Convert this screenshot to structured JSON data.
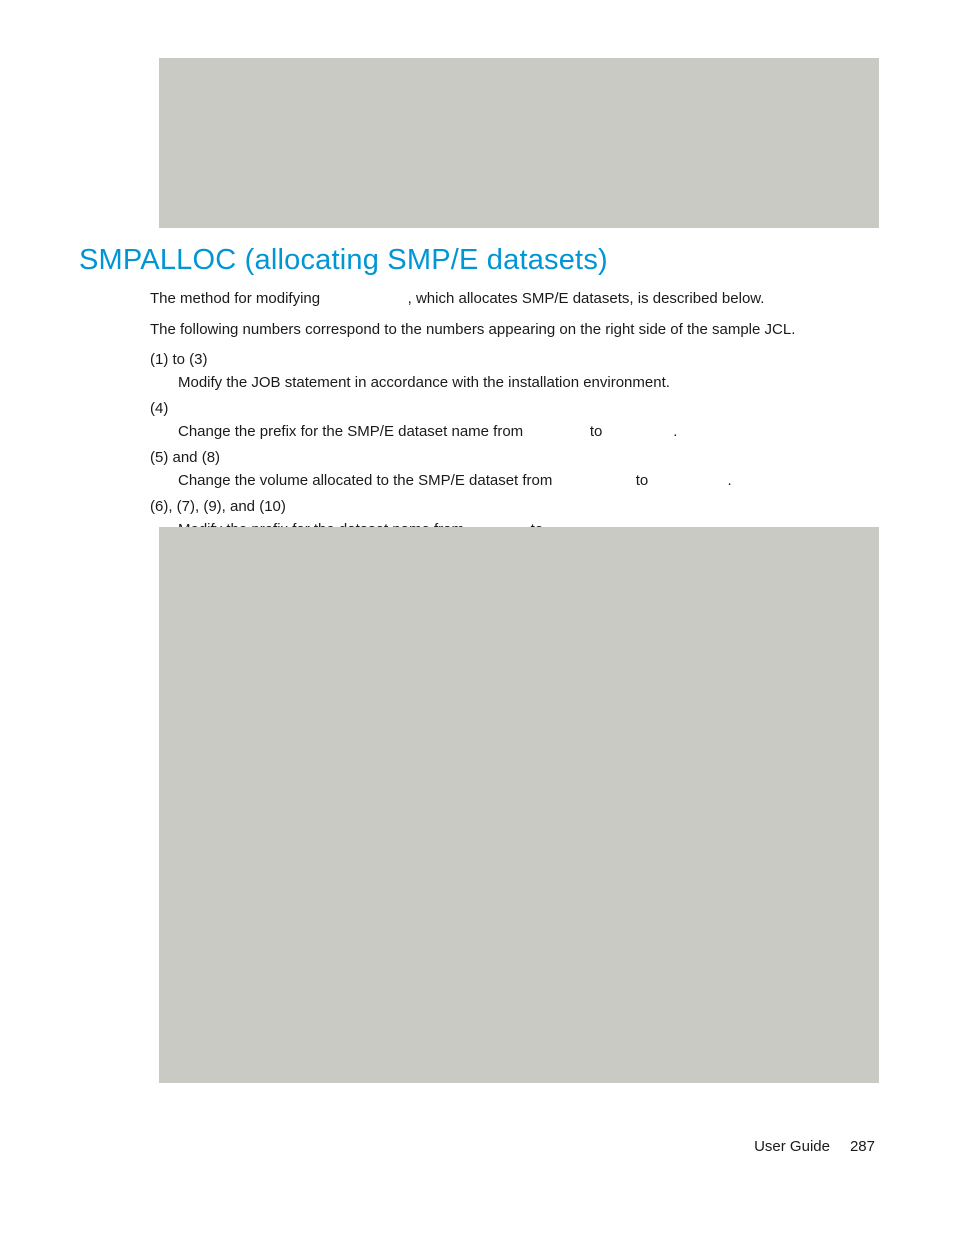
{
  "heading": "SMPALLOC (allocating SMP/E datasets)",
  "intro1_a": "The method for modifying ",
  "intro1_b": ", which allocates SMP/E datasets, is described below.",
  "intro2": "The following numbers correspond to the numbers appearing on the right side of the sample JCL.",
  "items": [
    {
      "label": "(1) to (3)",
      "desc": "Modify the JOB statement in accordance with the installation environment."
    },
    {
      "label": "(4)",
      "desc_a": "Change the prefix for the SMP/E dataset name from ",
      "desc_b": " to ",
      "desc_c": "."
    },
    {
      "label": "(5) and (8)",
      "desc_a": "Change the volume allocated to the SMP/E dataset from ",
      "desc_b": " to ",
      "desc_c": "."
    },
    {
      "label": "(6), (7), (9), and (10)",
      "desc_a": "Modify the prefix for the dataset name from ",
      "desc_b": " to ",
      "desc_c": "."
    }
  ],
  "gaps": {
    "intro_gap": "                    ",
    "item1_gap1": "              ",
    "item1_gap2": "                ",
    "item2_gap1": "                  ",
    "item2_gap2": "                  ",
    "item3_gap1": "              ",
    "item3_gap2": "                "
  },
  "footer": {
    "label": "User Guide",
    "page": "287"
  }
}
